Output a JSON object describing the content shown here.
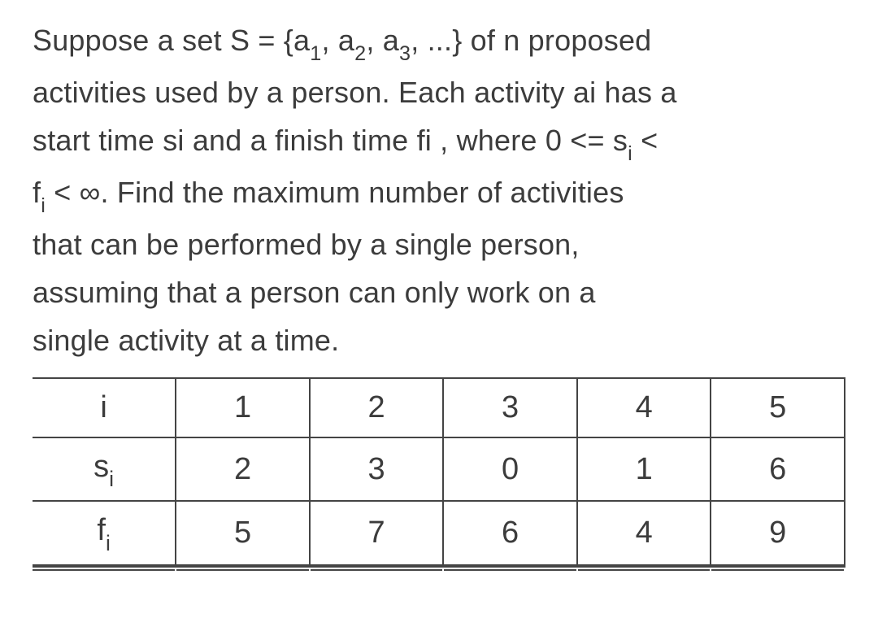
{
  "problem": {
    "line1_prefix": "Suppose a set S = {a",
    "line1_mid1": ", a",
    "line1_mid2": ", a",
    "line1_suffix": ", ...} of n proposed",
    "line2": "activities used by a person. Each activity ai has a",
    "line3_prefix": "start time si and a finish time fi , where 0 <= s",
    "line3_suffix": " <",
    "line4_prefix": "f",
    "line4_suffix": " < ∞. Find the maximum number of activities",
    "line5": "that can be performed by a single person,",
    "line6": "assuming that a person can only work on a",
    "line7": "single activity at a time.",
    "sub1": "1",
    "sub2": "2",
    "sub3": "3",
    "subi": "i"
  },
  "table": {
    "rows": [
      {
        "label": "i",
        "label_sub": "",
        "cells": [
          "1",
          "2",
          "3",
          "4",
          "5"
        ]
      },
      {
        "label": "s",
        "label_sub": "i",
        "cells": [
          "2",
          "3",
          "0",
          "1",
          "6"
        ]
      },
      {
        "label": "f",
        "label_sub": "i",
        "cells": [
          "5",
          "7",
          "6",
          "4",
          "9"
        ]
      }
    ]
  }
}
